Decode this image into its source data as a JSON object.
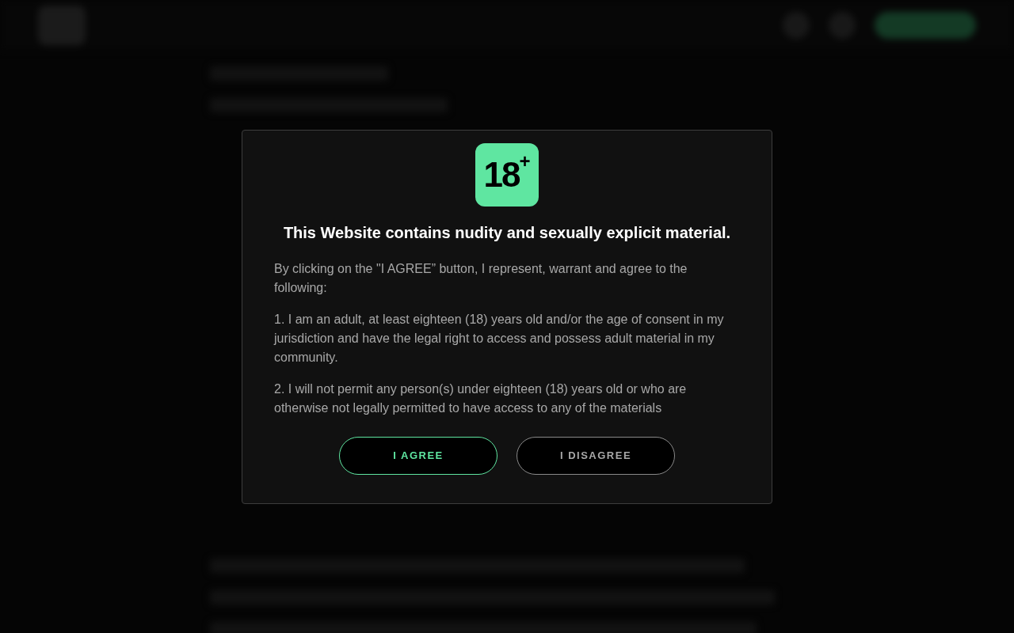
{
  "modal": {
    "badge": "18$^{+}$",
    "title": "This Website contains nudity and sexually explicit material.",
    "paragraphs": [
      "By clicking on the \"I AGREE” button, I represent, warrant and agree to the following:",
      "1. I am an adult, at least eighteen (18) years old and/or the age of consent in my jurisdiction and have the legal right to access and possess adult material in my community.",
      "2. I will not permit any person(s) under eighteen (18) years old or who are otherwise not legally permitted to have access to any of the materials"
    ],
    "buttons": [
      {
        "label": "I AGREE",
        "kind": "primary"
      },
      {
        "label": "I DISAGREE",
        "kind": "secondary"
      }
    ]
  }
}
